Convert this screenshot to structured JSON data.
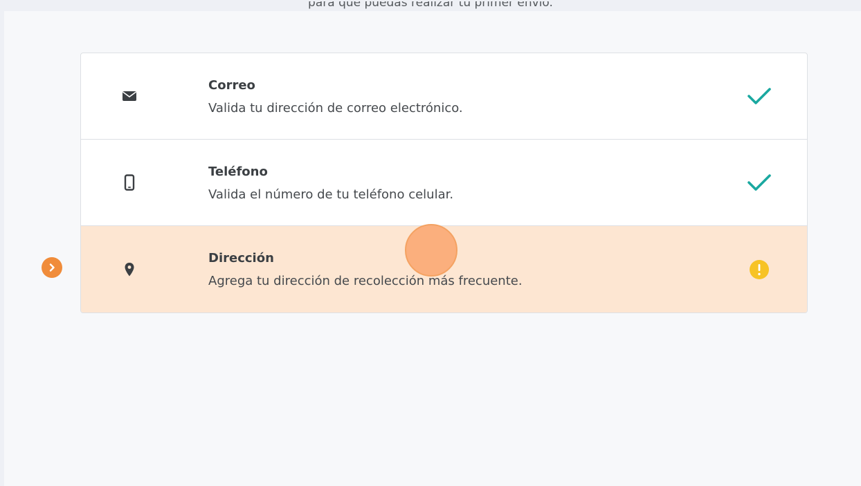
{
  "intro": {
    "text": "para que puedas realizar tu primer envío."
  },
  "steps": [
    {
      "icon": "envelope-icon",
      "title": "Correo",
      "description": "Valida tu dirección de correo electrónico.",
      "status": "completed",
      "status_icon": "check-icon"
    },
    {
      "icon": "mobile-phone-icon",
      "title": "Teléfono",
      "description": "Valida el número de tu teléfono celular.",
      "status": "completed",
      "status_icon": "check-icon"
    },
    {
      "icon": "map-pin-icon",
      "title": "Dirección",
      "description": "Agrega tu dirección de recolección más frecuente.",
      "status": "pending",
      "status_icon": "warning-icon"
    }
  ],
  "colors": {
    "check": "#1aa8a0",
    "warning": "#f7c325",
    "active_row": "#fde6d2",
    "marker": "#f08c3a"
  }
}
